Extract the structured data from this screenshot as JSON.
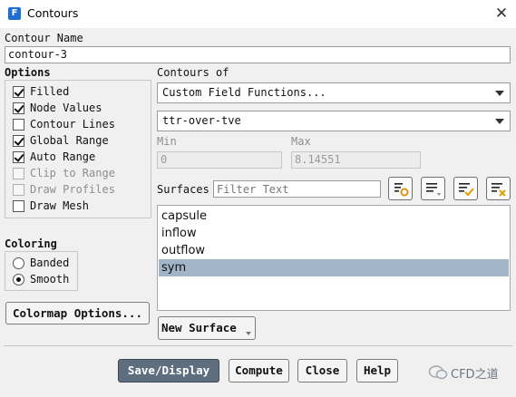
{
  "window": {
    "app_icon_letter": "F",
    "title": "Contours",
    "close_glyph": "✕"
  },
  "contour_name": {
    "label": "Contour Name",
    "value": "contour-3"
  },
  "options": {
    "title": "Options",
    "items": [
      {
        "label": "Filled",
        "checked": true,
        "enabled": true
      },
      {
        "label": "Node Values",
        "checked": true,
        "enabled": true
      },
      {
        "label": "Contour Lines",
        "checked": false,
        "enabled": true
      },
      {
        "label": "Global Range",
        "checked": true,
        "enabled": true
      },
      {
        "label": "Auto Range",
        "checked": true,
        "enabled": true
      },
      {
        "label": "Clip to Range",
        "checked": false,
        "enabled": false
      },
      {
        "label": "Draw Profiles",
        "checked": false,
        "enabled": false
      },
      {
        "label": "Draw Mesh",
        "checked": false,
        "enabled": true
      }
    ]
  },
  "coloring": {
    "title": "Coloring",
    "options": [
      {
        "label": "Banded",
        "selected": false
      },
      {
        "label": "Smooth",
        "selected": true
      }
    ]
  },
  "colormap_button": "Colormap Options...",
  "contours_of": {
    "label": "Contours of",
    "category": "Custom Field Functions...",
    "field": "ttr-over-tve"
  },
  "range": {
    "min_label": "Min",
    "min_value": "0",
    "max_label": "Max",
    "max_value": "8.14551"
  },
  "surfaces": {
    "label": "Surfaces",
    "filter_placeholder": "Filter Text",
    "tool_icons": [
      "new-surface-filter-icon",
      "sort-list-icon",
      "select-all-icon",
      "deselect-all-icon"
    ],
    "items": [
      {
        "label": "capsule",
        "selected": false
      },
      {
        "label": "inflow",
        "selected": false
      },
      {
        "label": "outflow",
        "selected": false
      },
      {
        "label": "sym",
        "selected": true
      }
    ],
    "new_surface_button": "New Surface"
  },
  "footer": {
    "save_display": "Save/Display",
    "compute": "Compute",
    "close": "Close",
    "help": "Help"
  },
  "watermark": {
    "text": "CFD之道"
  },
  "colors": {
    "selection": "#a2b4c8",
    "primary_button": "#5e6e7e",
    "app_icon": "#1f6fd1"
  }
}
